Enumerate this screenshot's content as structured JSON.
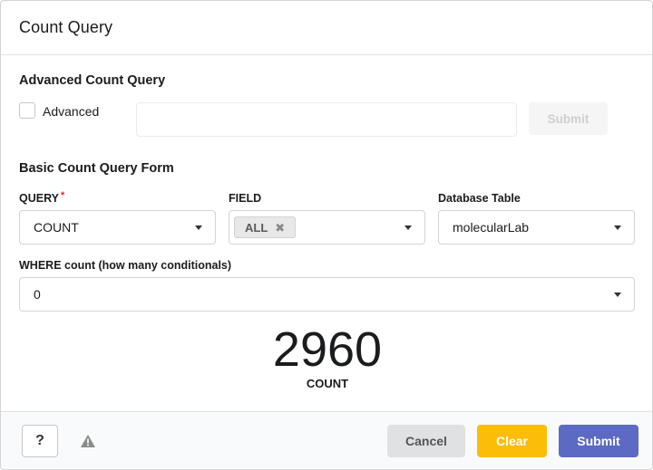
{
  "modal": {
    "title": "Count Query"
  },
  "advanced": {
    "section_title": "Advanced Count Query",
    "checkbox_label": "Advanced",
    "checked": false,
    "input_value": "",
    "submit_label": "Submit"
  },
  "basic": {
    "section_title": "Basic Count Query Form",
    "query": {
      "label": "QUERY",
      "required_mark": "*",
      "value": "COUNT"
    },
    "field": {
      "label": "FIELD",
      "chip": "ALL",
      "chip_remove": "✖"
    },
    "table": {
      "label": "Database Table",
      "value": "molecularLab"
    },
    "where": {
      "label": "WHERE count (how many conditionals)",
      "value": "0"
    }
  },
  "result": {
    "value": "2960",
    "label": "COUNT"
  },
  "footer": {
    "help_label": "?",
    "cancel_label": "Cancel",
    "clear_label": "Clear",
    "submit_label": "Submit"
  },
  "colors": {
    "clear": "#fbbd08",
    "submit": "#5c6ac4",
    "cancel": "#e0e1e2",
    "required": "#db2828"
  },
  "icons": {
    "warning": "warning-triangle-icon",
    "caret": "caret-down-icon",
    "remove": "remove-icon"
  }
}
